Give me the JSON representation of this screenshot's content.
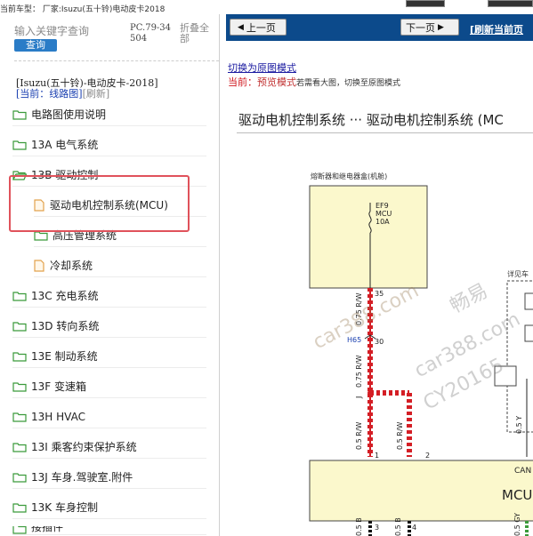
{
  "top": {
    "current_car": "当前车型：  厂家:Isuzu(五十铃)电动皮卡2018"
  },
  "left": {
    "search_placeholder": "输入关键字查询",
    "search_button": "查询",
    "pc_code": "PC.79-34504",
    "fold_all": "折叠全部",
    "breadcrumb_title": "[Isuzu(五十铃)-电动皮卡-2018]",
    "breadcrumb_current": "[当前：线路图]",
    "breadcrumb_refresh": "[刷新]",
    "tree": [
      {
        "label": "电路图使用说明",
        "icon": "folder"
      },
      {
        "label": "13A 电气系统",
        "icon": "folder"
      },
      {
        "label": "13B 驱动控制",
        "icon": "folder-open"
      },
      {
        "label": "驱动电机控制系统(MCU)",
        "icon": "document"
      },
      {
        "label": "高压管理系统",
        "icon": "folder"
      },
      {
        "label": "冷却系统",
        "icon": "document"
      },
      {
        "label": "13C 充电系统",
        "icon": "folder"
      },
      {
        "label": "13D 转向系统",
        "icon": "folder"
      },
      {
        "label": "13E 制动系统",
        "icon": "folder"
      },
      {
        "label": "13F 变速箱",
        "icon": "folder"
      },
      {
        "label": "13H HVAC",
        "icon": "folder"
      },
      {
        "label": "13I 乘客约束保护系统",
        "icon": "folder"
      },
      {
        "label": "13J 车身.驾驶室.附件",
        "icon": "folder"
      },
      {
        "label": "13K 车身控制",
        "icon": "folder"
      },
      {
        "label": "接插件",
        "icon": "folder"
      }
    ]
  },
  "right": {
    "prev_page": "上一页",
    "next_page": "下一页",
    "refresh_page": "[刷新当前页",
    "switch_mode": "切换为原图模式",
    "mode_key": "当前：",
    "mode_value": "预览模式",
    "mode_hint": "若需看大图，切换至原图模式",
    "page_title": "驱动电机控制系统 ··· 驱动电机控制系统 (MC",
    "diagram": {
      "fuse_box_label": "熔断器和继电器盒(机舱)",
      "fuse_id": "EF9",
      "fuse_name": "MCU",
      "fuse_rating": "10A",
      "see_label": "详见车",
      "pin_35": "35",
      "wire_1": "0.75 R/W",
      "conn_h65": "H65",
      "pin_30": "30",
      "wire_2": "0.75 R/W",
      "splice_j": "J",
      "wire_3": "0.5 R/W",
      "wire_4": "0.5 R/W",
      "wire_5": "0.5 Y",
      "pin_1": "1",
      "pin_2": "2",
      "can_label": "CAN",
      "mcu_label": "MCU",
      "pin_3": "3",
      "pin_4": "4",
      "wire_b1": "0.5 B",
      "wire_b2": "0.5 B",
      "wire_gy": "0.5 GY",
      "watermark_1": "car388.com",
      "watermark_2": "畅易",
      "watermark_3": "car388.com",
      "watermark_4": "CY20165"
    }
  },
  "colors": {
    "nav_bar": "#0c4a8b",
    "highlight_border": "#e0525b",
    "wire_red": "#d41e25",
    "fuse_box_fill": "#fbf8cc",
    "mcu_fill": "#fbf8cc"
  }
}
